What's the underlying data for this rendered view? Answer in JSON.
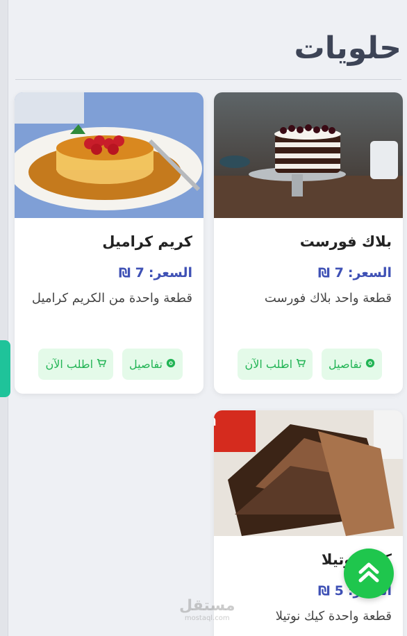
{
  "section": {
    "title": "حلويات"
  },
  "cards": [
    {
      "title": "بلاك فورست",
      "price_label": "السعر:",
      "price_value": "7 ₪",
      "description": "قطعة واحد بلاك فورست",
      "details_label": "تفاصيل",
      "order_label": "اطلب الآن",
      "image": "black-forest-cake"
    },
    {
      "title": "كريم كراميل",
      "price_label": "السعر:",
      "price_value": "7 ₪",
      "description": "قطعة واحدة من الكريم كراميل",
      "details_label": "تفاصيل",
      "order_label": "اطلب الآن",
      "image": "creme-caramel"
    },
    {
      "title": "كيك نوتيلا",
      "price_label": "السعر:",
      "price_value": "5 ₪",
      "description": "قطعة واحدة كيك نوتيلا",
      "image": "nutella-cake"
    }
  ],
  "watermark": {
    "text": "مستقل",
    "sub": "mostaql.com"
  },
  "colors": {
    "accent_green": "#1fc64d",
    "price_blue": "#3f51b5",
    "button_bg": "#e4fae9"
  }
}
